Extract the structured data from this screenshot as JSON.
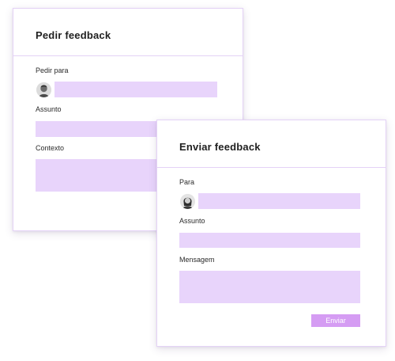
{
  "request_card": {
    "title": "Pedir feedback",
    "ask_for_label": "Pedir para",
    "subject_label": "Assunto",
    "context_label": "Contexto",
    "ask_for_value": "",
    "subject_value": "",
    "context_value": ""
  },
  "send_card": {
    "title": "Enviar feedback",
    "to_label": "Para",
    "subject_label": "Assunto",
    "message_label": "Mensagem",
    "to_value": "",
    "subject_value": "",
    "message_value": "",
    "send_label": "Enviar"
  },
  "colors": {
    "field_fill": "#e8d4fb",
    "button_fill": "#d59cf3",
    "card_border": "#e4d2f6"
  }
}
